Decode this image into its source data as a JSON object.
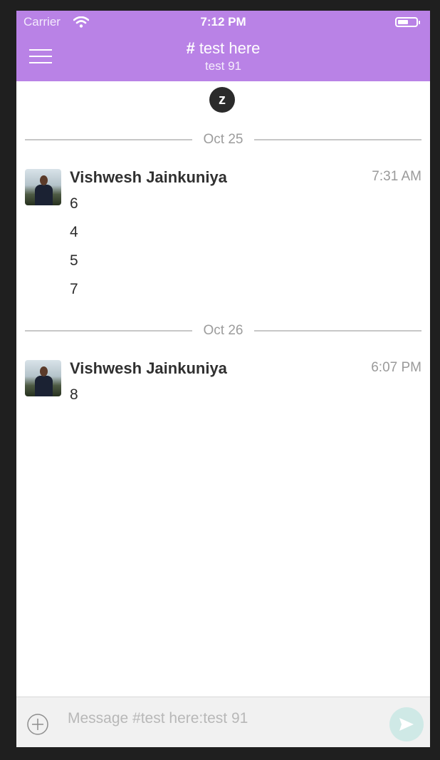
{
  "status_bar": {
    "carrier": "Carrier",
    "time": "7:12 PM"
  },
  "header": {
    "channel_prefix": "#",
    "channel_name": "test here",
    "subtitle": "test 91"
  },
  "logo": {
    "letter": "z"
  },
  "days": [
    {
      "label": "Oct 25",
      "messages": [
        {
          "sender": "Vishwesh Jainkuniya",
          "time": "7:31 AM",
          "lines": [
            "6",
            "4",
            "5",
            "7"
          ]
        }
      ]
    },
    {
      "label": "Oct 26",
      "messages": [
        {
          "sender": "Vishwesh Jainkuniya",
          "time": "6:07 PM",
          "lines": [
            "8"
          ]
        }
      ]
    }
  ],
  "composer": {
    "placeholder": "Message #test here:test 91"
  },
  "colors": {
    "header": "#b982e6",
    "send_button": "#cfe9e6",
    "background": "#ffffff"
  }
}
